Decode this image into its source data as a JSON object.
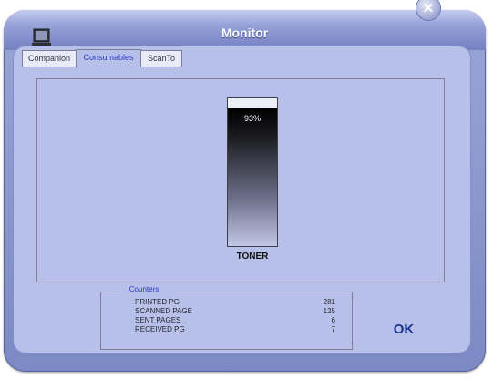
{
  "window": {
    "title": "Monitor",
    "app_icon": "monitor-icon",
    "close_icon": "close-icon",
    "close_glyph": "✕"
  },
  "tabs": [
    {
      "label": "Companion",
      "active": false
    },
    {
      "label": "Consumables",
      "active": true
    },
    {
      "label": "ScanTo",
      "active": false
    }
  ],
  "toner": {
    "label": "TONER",
    "percent_text": "93%",
    "level": 93
  },
  "counters": {
    "legend": "Counters",
    "rows": [
      {
        "label": "PRINTED PG",
        "value": "281"
      },
      {
        "label": "SCANNED PAGE",
        "value": "125"
      },
      {
        "label": "SENT PAGES",
        "value": "6"
      },
      {
        "label": "RECEIVED PG",
        "value": "7"
      }
    ]
  },
  "ok_label": "OK",
  "colors": {
    "accent": "#2c39c4",
    "ok": "#1d3390",
    "panel": "#b7c0e8"
  }
}
